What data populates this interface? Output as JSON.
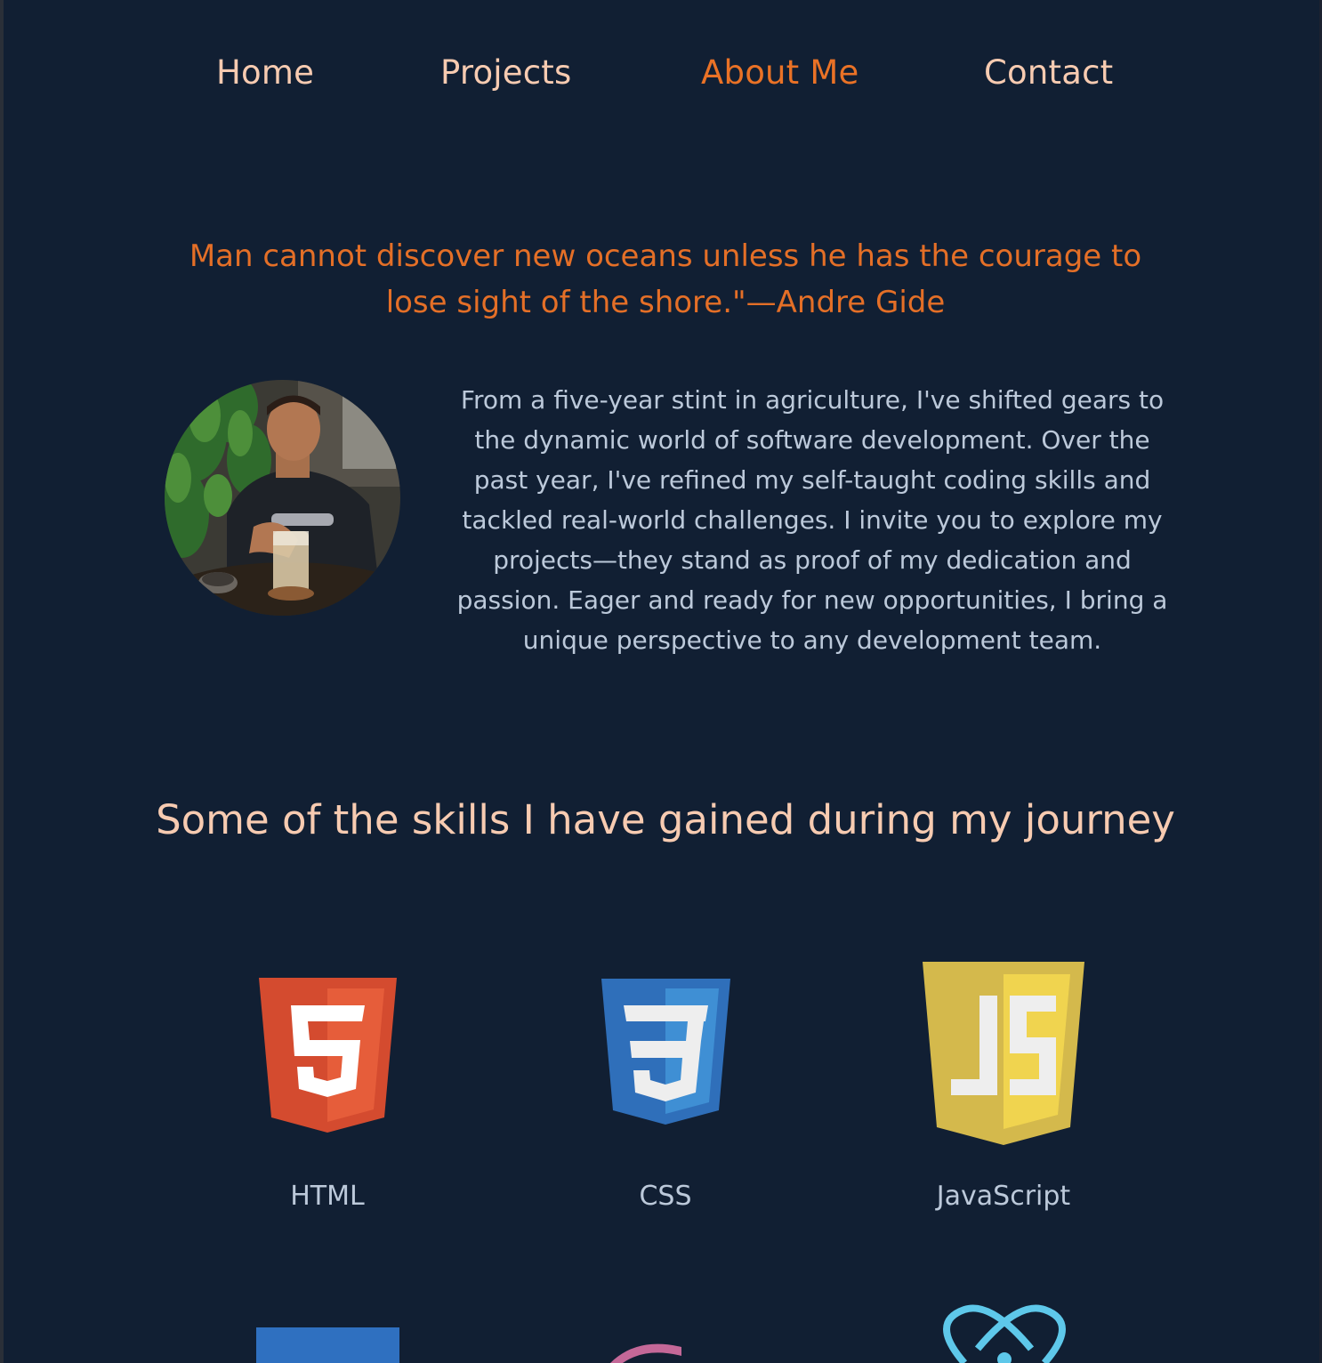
{
  "nav": {
    "items": [
      {
        "label": "Home",
        "active": false
      },
      {
        "label": "Projects",
        "active": false
      },
      {
        "label": "About Me",
        "active": true
      },
      {
        "label": "Contact",
        "active": false
      }
    ]
  },
  "about": {
    "quote": "Man cannot discover new oceans unless he has the courage to lose sight of the shore.\"—Andre Gide",
    "bio": "From a five-year stint in agriculture, I've shifted gears to the dynamic world of software development. Over the past year, I've refined my self-taught coding skills and tackled real-world challenges. I invite you to explore my projects—they stand as proof of my dedication and passion. Eager and ready for new opportunities, I bring a unique perspective to any development team."
  },
  "skills": {
    "title": "Some of the skills I have gained during my journey",
    "items": [
      {
        "label": "HTML",
        "icon": "html5-icon"
      },
      {
        "label": "CSS",
        "icon": "css3-icon"
      },
      {
        "label": "JavaScript",
        "icon": "javascript-icon"
      }
    ]
  },
  "colors": {
    "background": "#111f33",
    "accent": "#ea7226",
    "nav_text": "#f7cbb1",
    "body_text": "#bcc9da"
  }
}
